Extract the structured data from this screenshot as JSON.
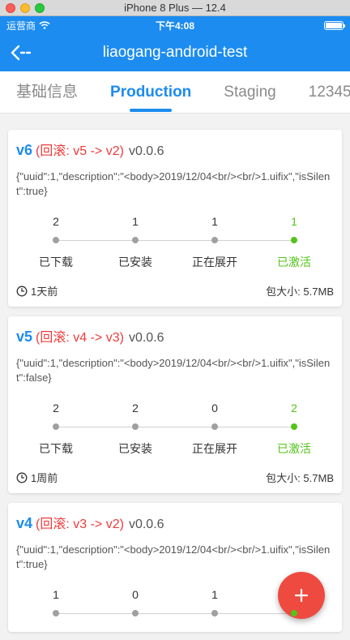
{
  "window": {
    "title": "iPhone 8 Plus — 12.4"
  },
  "status_bar": {
    "carrier": "运营商",
    "time": "下午4:08"
  },
  "navbar": {
    "title": "liaogang-android-test"
  },
  "tabs": [
    {
      "label": "基础信息",
      "active": false
    },
    {
      "label": "Production",
      "active": true
    },
    {
      "label": "Staging",
      "active": false
    },
    {
      "label": "12345",
      "active": false
    }
  ],
  "stat_labels": [
    "已下载",
    "已安装",
    "正在展开",
    "已激活"
  ],
  "size_label": "包大小:",
  "releases": [
    {
      "version": "v6",
      "rollback": "(回滚: v5 -> v2)",
      "app_version": "v0.0.6",
      "description": "{\"uuid\":1,\"description\":\"<body>2019/12/04<br/><br/>1.uifix\",\"isSilent\":true}",
      "stats": [
        "2",
        "1",
        "1",
        "1"
      ],
      "time_ago": "1天前",
      "size": "5.7MB"
    },
    {
      "version": "v5",
      "rollback": "(回滚: v4 -> v3)",
      "app_version": "v0.0.6",
      "description": "{\"uuid\":1,\"description\":\"<body>2019/12/04<br/><br/>1.uifix\",\"isSilent\":false}",
      "stats": [
        "2",
        "2",
        "0",
        "2"
      ],
      "time_ago": "1周前",
      "size": "5.7MB"
    },
    {
      "version": "v4",
      "rollback": "(回滚: v3 -> v2)",
      "app_version": "v0.0.6",
      "description": "{\"uuid\":1,\"description\":\"<body>2019/12/04<br/><br/>1.uifix\",\"isSilent\":true}",
      "stats": [
        "1",
        "0",
        "1",
        ""
      ],
      "time_ago": "",
      "size": ""
    }
  ],
  "fab": {
    "icon": "plus-icon"
  },
  "colors": {
    "primary": "#1c8cf0",
    "rollback": "#ef3b3b",
    "activated": "#52c41a",
    "fab": "#ee4a3f"
  }
}
